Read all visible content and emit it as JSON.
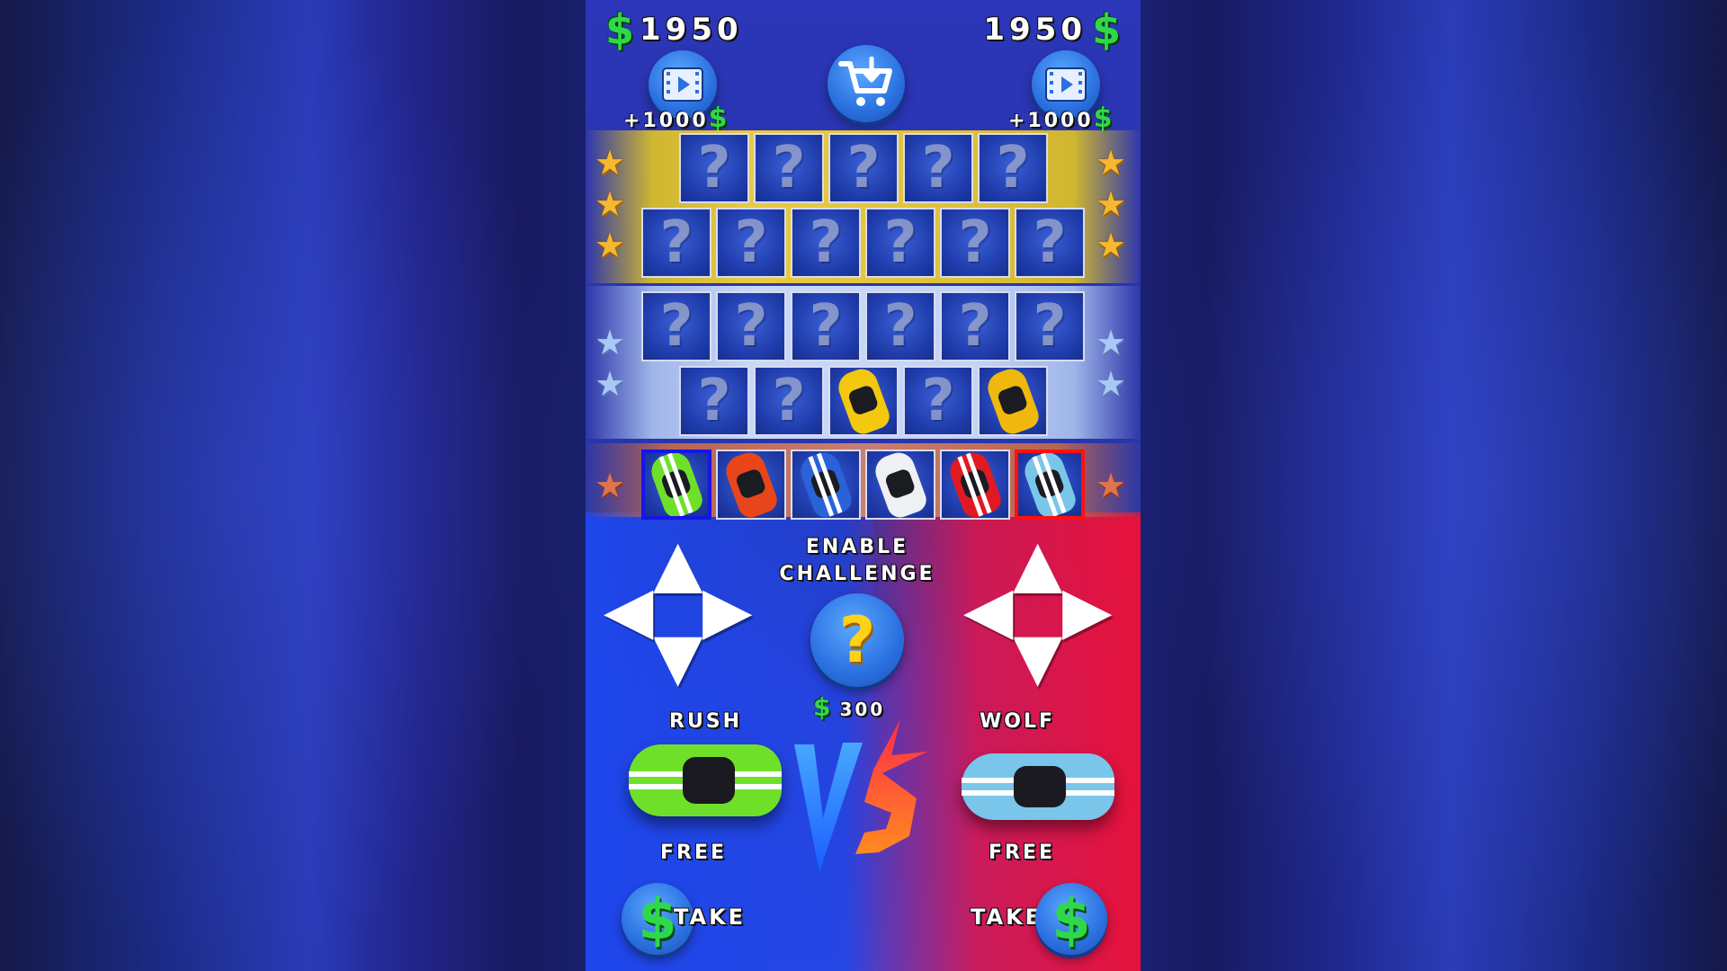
{
  "player_left": {
    "bank": "1950",
    "currency": "$",
    "ad_bonus": "+1000",
    "name": "RUSH",
    "price": "FREE",
    "take_label": "TAKE"
  },
  "player_right": {
    "bank": "1950",
    "currency": "$",
    "ad_bonus": "+1000",
    "name": "WOLF",
    "price": "FREE",
    "take_label": "TAKE"
  },
  "challenge": {
    "line1": "ENABLE",
    "line2": "CHALLENGE",
    "cost": "300",
    "icon": "?"
  },
  "vs_label": "VS",
  "locked_glyph": "?",
  "tiers": {
    "gold": {
      "row1": [
        "locked",
        "locked",
        "locked",
        "locked",
        "locked"
      ],
      "row2": [
        "locked",
        "locked",
        "locked",
        "locked",
        "locked",
        "locked"
      ]
    },
    "silver": {
      "row1": [
        "locked",
        "locked",
        "locked",
        "locked",
        "locked",
        "locked"
      ],
      "row2": [
        "locked",
        "locked",
        "yellow-car",
        "locked",
        "yellow-car"
      ]
    },
    "bronze": {
      "row1": [
        "green-car",
        "orange-car",
        "blue-car",
        "white-car",
        "red-car",
        "lightblue-car"
      ]
    }
  },
  "colors": {
    "accent_green": "#2fd84a",
    "player_blue": "#1515e8",
    "player_red": "#ff1010",
    "gold": "#f2d23a",
    "silver": "#c9d8f8",
    "bronze": "#d9886a"
  }
}
